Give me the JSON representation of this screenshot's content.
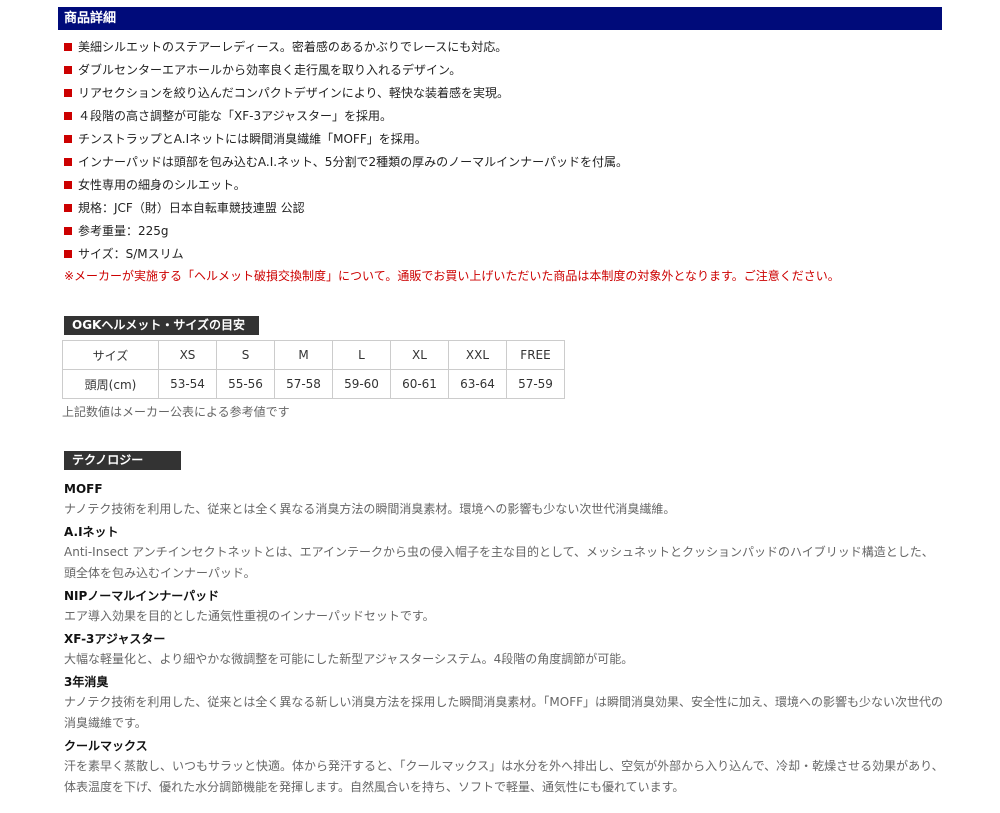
{
  "details": {
    "header": "商品詳細",
    "features": [
      "美細シルエットのステアーレディース。密着感のあるかぶりでレースにも対応。",
      "ダブルセンターエアホールから効率良く走行風を取り入れるデザイン。",
      "リアセクションを絞り込んだコンパクトデザインにより、軽快な装着感を実現。",
      "４段階の高さ調整が可能な「XF-3アジャスター」を採用。",
      "チンストラップとA.Iネットには瞬間消臭繊維「MOFF」を採用。",
      "インナーパッドは頭部を包み込むA.I.ネット、5分割で2種類の厚みのノーマルインナーパッドを付属。",
      "女性専用の細身のシルエット。",
      "規格：JCF（財）日本自転車競技連盟 公認",
      "参考重量：225g",
      "サイズ：S/Mスリム"
    ],
    "notice": "※メーカーが実施する「ヘルメット破損交換制度」について。通販でお買い上げいただいた商品は本制度の対象外となります。ご注意ください。"
  },
  "size_guide": {
    "label": "OGKヘルメット・サイズの目安",
    "header_row": [
      "サイズ",
      "XS",
      "S",
      "M",
      "L",
      "XL",
      "XXL",
      "FREE"
    ],
    "data_row": [
      "頭周(cm)",
      "53-54",
      "55-56",
      "57-58",
      "59-60",
      "60-61",
      "63-64",
      "57-59"
    ],
    "note": "上記数値はメーカー公表による参考値です"
  },
  "technology": {
    "label": "テクノロジー",
    "items": [
      {
        "name": "MOFF",
        "desc": "ナノテク技術を利用した、従来とは全く異なる消臭方法の瞬間消臭素材。環境への影響も少ない次世代消臭繊維。"
      },
      {
        "name": "A.Iネット",
        "desc": "Anti-Insect アンチインセクトネットとは、エアインテークから虫の侵入帽子を主な目的として、メッシュネットとクッションパッドのハイブリッド構造とした、頭全体を包み込むインナーパッド。"
      },
      {
        "name": "NIPノーマルインナーパッド",
        "desc": "エア導入効果を目的とした通気性重視のインナーパッドセットです。"
      },
      {
        "name": "XF-3アジャスター",
        "desc": "大幅な軽量化と、より細やかな微調整を可能にした新型アジャスターシステム。4段階の角度調節が可能。"
      },
      {
        "name": "3年消臭",
        "desc": "ナノテク技術を利用した、従来とは全く異なる新しい消臭方法を採用した瞬間消臭素材。「MOFF」は瞬間消臭効果、安全性に加え、環境への影響も少ない次世代の消臭繊維です。"
      },
      {
        "name": "クールマックス",
        "desc": "汗を素早く蒸散し、いつもサラッと快適。体から発汗すると、「クールマックス」は水分を外へ排出し、空気が外部から入り込んで、冷却・乾燥させる効果があり、体表温度を下げ、優れた水分調節機能を発揮します。自然風合いを持ち、ソフトで軽量、通気性にも優れています。"
      }
    ]
  },
  "colors": {
    "header_bg": "#000b7a",
    "bullet": "#cc0000",
    "notice": "#cc0000",
    "label_bg": "#333333"
  }
}
